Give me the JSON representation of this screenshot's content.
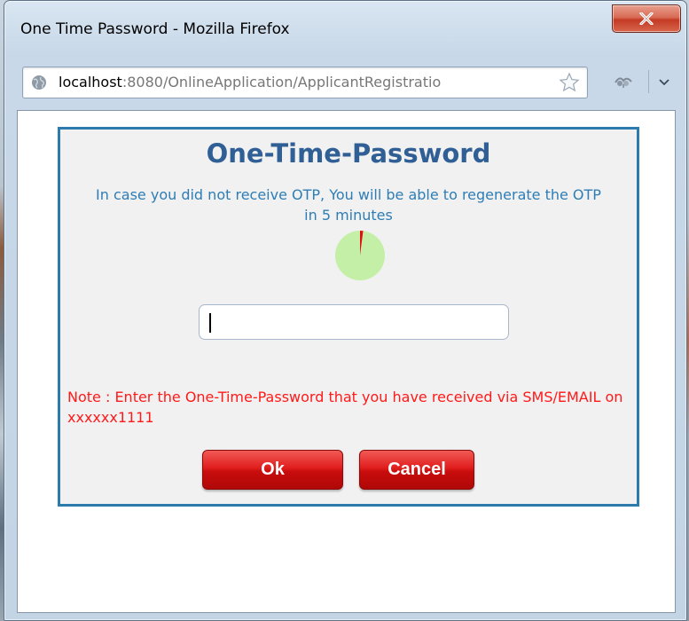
{
  "window": {
    "title": "One Time Password - Mozilla Firefox"
  },
  "urlbar": {
    "host": "localhost",
    "rest": ":8080/OnlineApplication/ApplicantRegistratio"
  },
  "dialog": {
    "title": "One-Time-Password",
    "info": "In case you did not receive OTP, You will be able to regenerate the OTP in 5 minutes",
    "otp_input": {
      "value": "",
      "placeholder": ""
    },
    "note": "Note : Enter the One-Time-Password that you have received via SMS/EMAIL on xxxxxx1111",
    "ok_label": "Ok",
    "cancel_label": "Cancel"
  },
  "timer": {
    "elapsed_fraction": 0.02
  },
  "icons": {
    "close": "close-icon",
    "globe": "globe-icon",
    "star": "star-icon",
    "addon": "addon-icon",
    "menu": "chevron-down-icon"
  },
  "colors": {
    "dialog_border": "#2c7bae",
    "title": "#2f5f94",
    "info_text": "#2e7db5",
    "note_text": "#ff1a1a",
    "button_red": "#e01e1e",
    "timer_green": "#c3f0a6",
    "timer_red": "#e01010"
  }
}
